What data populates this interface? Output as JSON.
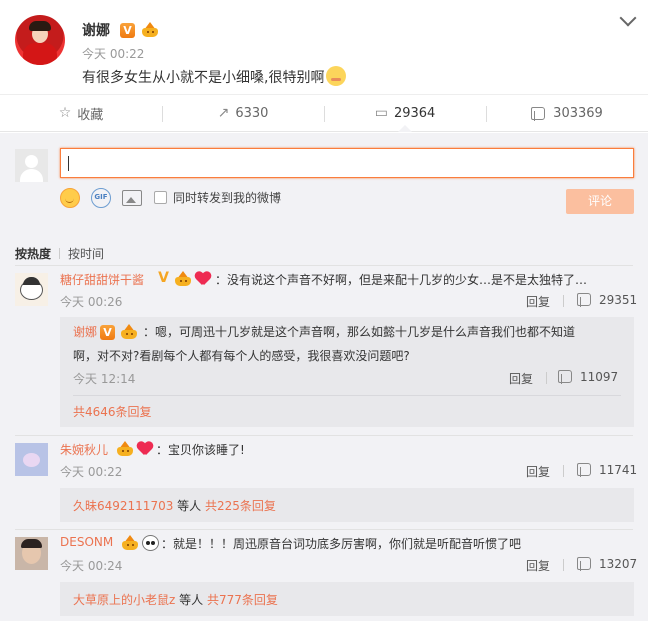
{
  "post": {
    "author": "谢娜",
    "verified_badge": "V",
    "time": "今天 00:22",
    "text": "有很多女生从小就不是小细嗓,很特别啊",
    "emoji": "shy-face-icon"
  },
  "actions": {
    "favorite": "收藏",
    "repost": "6330",
    "comment": "29364",
    "like": "303369"
  },
  "composer": {
    "placeholder": "",
    "also_repost": "同时转发到我的微博",
    "submit": "评论"
  },
  "sort": {
    "hot": "按热度",
    "time": "按时间"
  },
  "comments": [
    {
      "author": "糖仔甜甜饼干酱",
      "text": "：没有说这个声音不好啊，但是来配十几岁的少女…是不是太独特了…",
      "time": "今天 00:26",
      "reply": "回复",
      "likes": "29351",
      "sub": {
        "author": "谢娜",
        "verified_badge": "V",
        "line1": "：嗯，可周迅十几岁就是这个声音啊，那么如懿十几岁是什么声音我们也都不知道",
        "line2": "啊，对不对?看剧每个人都有每个人的感受，我很喜欢没问题吧?",
        "time": "今天 12:14",
        "reply": "回复",
        "likes": "11097",
        "more": "共4646条回复"
      }
    },
    {
      "author": "朱婉秋儿",
      "text": "：宝贝你该睡了!",
      "time": "今天 00:22",
      "reply": "回复",
      "likes": "11741",
      "more_user": "久昧6492111703",
      "more_mid": " 等人 ",
      "more_count": "共225条回复"
    },
    {
      "author": "DESONM",
      "text": "：就是！！！周迅原音台词功底多厉害啊，你们就是听配音听惯了吧",
      "time": "今天 00:24",
      "reply": "回复",
      "likes": "13207",
      "more_user": "大草原上的小老鼠z",
      "more_mid": " 等人 ",
      "more_count": "共777条回复"
    }
  ],
  "colors": {
    "accent": "#eb7350",
    "link": "#eb7350",
    "submit_disabled": "#fbbf9f",
    "panel": "#f2f2f5"
  }
}
